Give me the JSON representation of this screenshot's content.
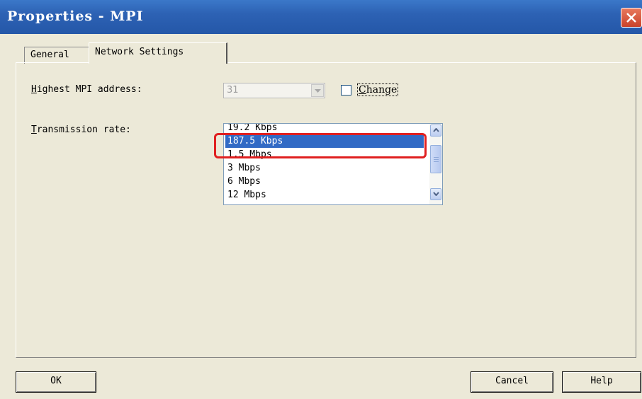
{
  "window": {
    "title": "Properties - MPI"
  },
  "tabs": [
    {
      "label": "General",
      "active": false
    },
    {
      "label": "Network Settings",
      "active": true
    }
  ],
  "highest_address": {
    "label_first": "H",
    "label_rest": "ighest MPI address:",
    "value": "31",
    "enabled": false,
    "change_checkbox": {
      "label_first": "C",
      "label_rest": "hange",
      "checked": false
    }
  },
  "transmission_rate": {
    "label_first": "T",
    "label_rest": "ransmission rate:",
    "options": [
      "19.2 Kbps",
      "187.5 Kbps",
      "1.5 Mbps",
      "3 Mbps",
      "6 Mbps",
      "12 Mbps"
    ],
    "selected": "187.5 Kbps"
  },
  "buttons": {
    "ok": "OK",
    "cancel": "Cancel",
    "help": "Help"
  },
  "colors": {
    "titlebar": "#2457a8",
    "selection": "#316ac5",
    "highlight_box": "#e02020",
    "dialog_bg": "#ece9d8"
  }
}
